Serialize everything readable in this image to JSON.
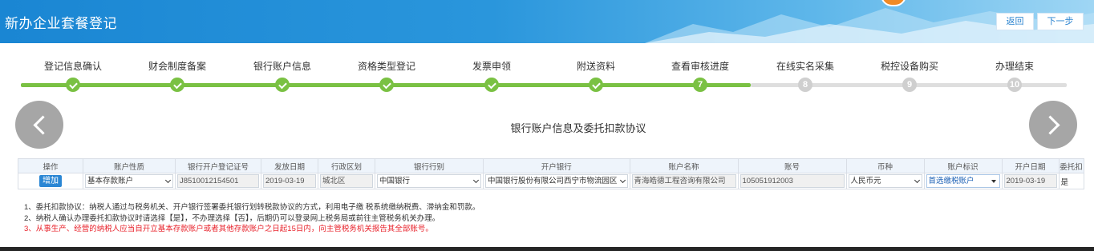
{
  "header": {
    "title": "新办企业套餐登记",
    "back_label": "返回",
    "next_label": "下一步"
  },
  "steps": [
    {
      "label": "登记信息确认",
      "status": "done",
      "number": ""
    },
    {
      "label": "财会制度备案",
      "status": "done",
      "number": ""
    },
    {
      "label": "银行账户信息",
      "status": "done",
      "number": ""
    },
    {
      "label": "资格类型登记",
      "status": "done",
      "number": ""
    },
    {
      "label": "发票申领",
      "status": "done",
      "number": ""
    },
    {
      "label": "附送资料",
      "status": "done",
      "number": ""
    },
    {
      "label": "查看审核进度",
      "status": "current",
      "number": "7"
    },
    {
      "label": "在线实名采集",
      "status": "todo",
      "number": "8"
    },
    {
      "label": "税控设备购买",
      "status": "todo",
      "number": "9"
    },
    {
      "label": "办理结束",
      "status": "todo",
      "number": "10"
    }
  ],
  "section_title": "银行账户信息及委托扣款协议",
  "table": {
    "headers": [
      "操作",
      "账户性质",
      "银行开户登记证号",
      "发放日期",
      "行政区划",
      "银行行别",
      "开户银行",
      "账户名称",
      "账号",
      "币种",
      "账户标识",
      "开户日期",
      "委托扣"
    ],
    "row": {
      "action": "增加",
      "account_type": "基本存款账户",
      "reg_no": "J8510012154501",
      "issue_date": "2019-03-19",
      "district": "城北区",
      "bank_category": "中国银行",
      "bank_branch": "中国银行股份有限公司西宁市物流园区",
      "account_name": "青海皓德工程咨询有限公司",
      "account_no": "105051912003",
      "currency": "人民币元",
      "account_flag": "首选缴税账户",
      "open_date": "2019-03-19",
      "entrust": "是"
    }
  },
  "notes": [
    "1、委托扣款协议：纳税人通过与税务机关、开户银行签署委托银行划转税款协议的方式，利用电子缴 税系统缴纳税费、滞纳金和罚款。",
    "2、纳税人确认办理委托扣款协议时请选择【是】，不办理选择【否】，后期仍可以登录网上税务局或前往主管税务机关办理。",
    "3、从事生产、经营的纳税人应当自开立基本存款账户或者其他存款账户之日起15日内，向主管税务机关报告其全部账号。"
  ],
  "colors": {
    "header_blue": "#1a86d3",
    "progress_done": "#7ac143",
    "progress_todo": "#dedede",
    "warning_red": "#e8212a"
  }
}
